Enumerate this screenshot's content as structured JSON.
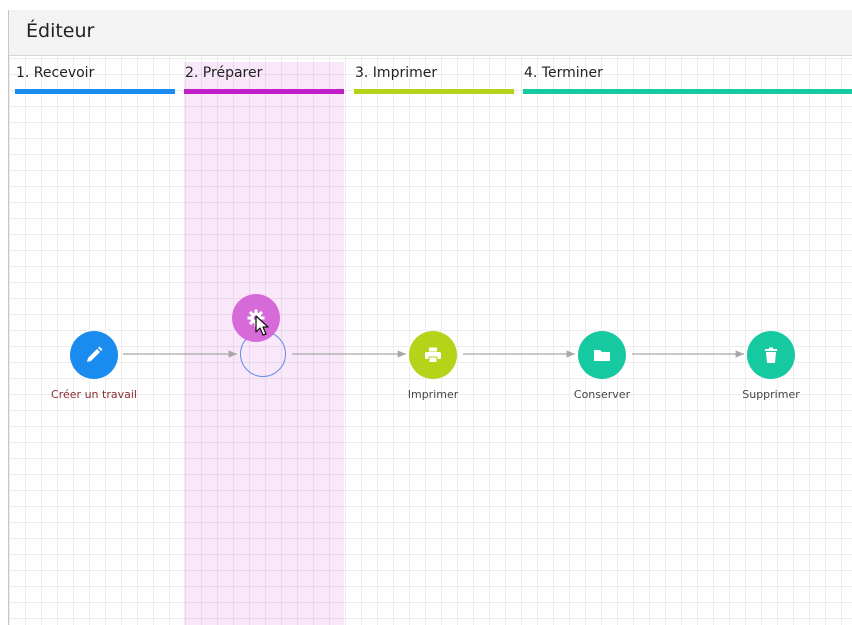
{
  "window": {
    "title": "Éditeur"
  },
  "stages": [
    {
      "label": "1. Recevoir",
      "color": "#1a8cf0"
    },
    {
      "label": "2. Préparer",
      "color": "#c01ec8"
    },
    {
      "label": "3. Imprimer",
      "color": "#b5d318"
    },
    {
      "label": "4. Terminer",
      "color": "#16c9a0"
    }
  ],
  "nodes": {
    "create": {
      "label": "Créer un travail",
      "icon": "pencil-icon",
      "color": "#1a8cf0",
      "label_color": "#8a2e2e"
    },
    "prepare_drag": {
      "icon": "gear-icon",
      "color": "#d76ad9"
    },
    "print": {
      "label": "Imprimer",
      "icon": "printer-icon",
      "color": "#b5d318",
      "label_color": "#444444"
    },
    "store": {
      "label": "Conserver",
      "icon": "folder-icon",
      "color": "#16c9a0",
      "label_color": "#444444"
    },
    "delete": {
      "label": "Supprimer",
      "icon": "trash-icon",
      "color": "#16c9a0",
      "label_color": "#444444"
    }
  }
}
